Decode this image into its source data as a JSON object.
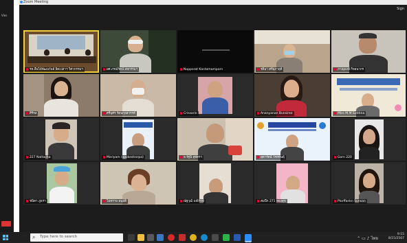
{
  "window": {
    "title": "Zoom Meeting",
    "sign_label": "Sign"
  },
  "left_panel": {
    "label": "Vies"
  },
  "participants": [
    {
      "name": "รท.อื่นไม้พัฒนวันธ์ ผิดเปล่าฯ วิศวกรรมฯ"
    },
    {
      "name": "ผศ.ภรณ์รัตน์ สหกรรมฯ"
    },
    {
      "name": "Nopporat Kantamamporn"
    },
    {
      "name": "รติมา ศรีสุภาฤดี"
    },
    {
      "name": "ภาณุพงษ์ กิจธนากร"
    },
    {
      "name": "ศิรีรส"
    },
    {
      "name": "ศรีบุศร รัตนกุลสวรรค์"
    },
    {
      "name": "Crissarin"
    },
    {
      "name": "Ananyanan Bunsiree"
    },
    {
      "name": "Miss M.M.Sutitina"
    },
    {
      "name": "227 Nattacha"
    },
    {
      "name": "Mariyam (spokestrorpa)"
    },
    {
      "name": "อ.รัฐนิ สุพัตรา"
    },
    {
      "name": "สุดารัตน์ วัชรพันธุ์"
    },
    {
      "name": "Gorn 220"
    },
    {
      "name": "ชนิดา ภูธรา"
    },
    {
      "name": "ไม่ทราบ อนุมัติ"
    },
    {
      "name": "ณัฐวุฒิ มณีรักษ์"
    },
    {
      "name": "สมนึก 271 ทองสุข"
    },
    {
      "name": "Plorffankn Sunsan"
    }
  ],
  "taskbar": {
    "search_placeholder": "Type here to search",
    "time": "9:15",
    "date": "8/15/2567"
  }
}
